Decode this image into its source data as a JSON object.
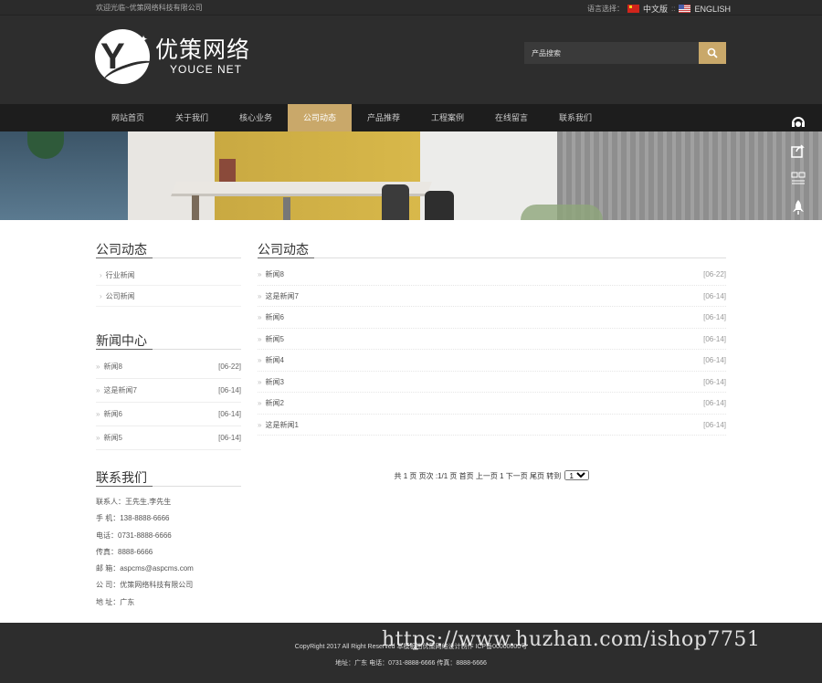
{
  "topbar": {
    "welcome": "欢迎光临~优策网络科技有限公司",
    "lang_label": "语言选择：",
    "lang_cn": "中文版",
    "lang_sep": "::",
    "lang_en": "ENGLISH"
  },
  "header": {
    "logo_cn": "优策网络",
    "logo_en": "YOUCE NET",
    "search_placeholder": "产品搜索"
  },
  "nav": {
    "items": [
      {
        "label": "网站首页",
        "active": false
      },
      {
        "label": "关于我们",
        "active": false
      },
      {
        "label": "核心业务",
        "active": false
      },
      {
        "label": "公司动态",
        "active": true
      },
      {
        "label": "产品推荐",
        "active": false
      },
      {
        "label": "工程案例",
        "active": false
      },
      {
        "label": "在线留言",
        "active": false
      },
      {
        "label": "联系我们",
        "active": false
      }
    ]
  },
  "float_bar": [
    "headset-icon",
    "share-icon",
    "qrcode-icon",
    "rocket-icon"
  ],
  "left": {
    "category_title": "公司动态",
    "categories": [
      "行业新闻",
      "公司新闻"
    ],
    "news_title": "新闻中心",
    "news": [
      {
        "title": "新闻8",
        "date": "[06-22]"
      },
      {
        "title": "这是新闻7",
        "date": "[06-14]"
      },
      {
        "title": "新闻6",
        "date": "[06-14]"
      },
      {
        "title": "新闻5",
        "date": "[06-14]"
      }
    ],
    "contact_title": "联系我们",
    "contact": [
      "联系人：王先生,李先生",
      "手 机：138-8888-6666",
      "电话：0731-8888-6666",
      "传真：8888-6666",
      "邮 箱：aspcms@aspcms.com",
      "公 司：优策网络科技有限公司",
      "地 址：广东"
    ]
  },
  "main": {
    "title": "公司动态",
    "news": [
      {
        "title": "新闻8",
        "date": "[06-22]"
      },
      {
        "title": "这是新闻7",
        "date": "[06-14]"
      },
      {
        "title": "新闻6",
        "date": "[06-14]"
      },
      {
        "title": "新闻5",
        "date": "[06-14]"
      },
      {
        "title": "新闻4",
        "date": "[06-14]"
      },
      {
        "title": "新闻3",
        "date": "[06-14]"
      },
      {
        "title": "新闻2",
        "date": "[06-14]"
      },
      {
        "title": "这是新闻1",
        "date": "[06-14]"
      }
    ],
    "pager_text": "共 1 页 页次 :1/1 页 首页 上一页 1 下一页 尾页 转到",
    "pager_select": "1"
  },
  "footer": {
    "line1": "CopyRight 2017 All Right Reserved 本模板由优策网络设计制作 ICP备00000000号",
    "line2": "地址：广东 电话：0731-8888-6666 传真：8888-6666"
  },
  "watermark": "https://www.huzhan.com/ishop7751",
  "colors": {
    "accent": "#c9a86a",
    "header_bg": "#2d2d2d",
    "nav_bg": "#1d1d1d"
  }
}
